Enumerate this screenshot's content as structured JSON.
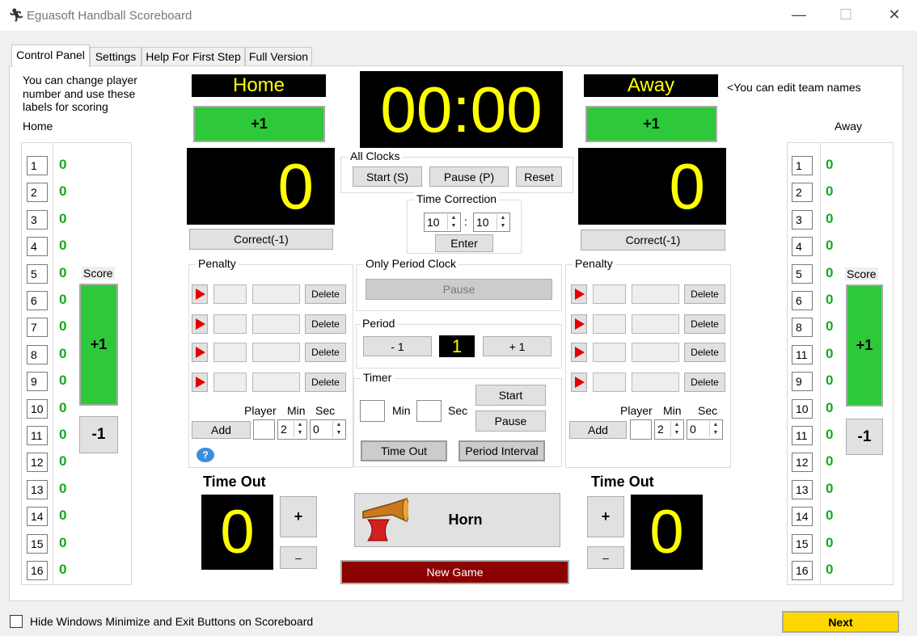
{
  "window": {
    "title": "Eguasoft Handball Scoreboard",
    "app_icon": "player-icon",
    "min": "—",
    "max": "☐",
    "close": "✕"
  },
  "tabs": [
    {
      "label": "Control Panel"
    },
    {
      "label": "Settings"
    },
    {
      "label": "Help For First Step"
    },
    {
      "label": "Full Version"
    }
  ],
  "left_note": {
    "line1": "You can change player",
    "line2": "number and use these",
    "line3": "labels for scoring",
    "side": "Home"
  },
  "right_note": {
    "edit_names": "<You can edit team names",
    "side": "Away"
  },
  "home": {
    "name": "Home",
    "plus": "+1",
    "score": "0",
    "correct": "Correct(-1)",
    "players": [
      "1",
      "2",
      "3",
      "4",
      "5",
      "6",
      "7",
      "8",
      "9",
      "10",
      "11",
      "12",
      "13",
      "14",
      "15",
      "16"
    ],
    "player_scores": [
      "0",
      "0",
      "0",
      "0",
      "0",
      "0",
      "0",
      "0",
      "0",
      "0",
      "0",
      "0",
      "0",
      "0",
      "0",
      "0"
    ],
    "score_label": "Score",
    "side_plus": "+1",
    "side_minus": "-1",
    "timeout_title": "Time Out",
    "timeout_value": "0",
    "timeout_plus": "+",
    "timeout_minus": "–"
  },
  "away": {
    "name": "Away",
    "plus": "+1",
    "score": "0",
    "correct": "Correct(-1)",
    "players": [
      "1",
      "2",
      "3",
      "4",
      "5",
      "6",
      "8",
      "11",
      "9",
      "10",
      "11",
      "12",
      "13",
      "14",
      "15",
      "16"
    ],
    "player_scores": [
      "0",
      "0",
      "0",
      "0",
      "0",
      "0",
      "0",
      "0",
      "0",
      "0",
      "0",
      "0",
      "0",
      "0",
      "0",
      "0"
    ],
    "score_label": "Score",
    "side_plus": "+1",
    "side_minus": "-1",
    "timeout_title": "Time Out",
    "timeout_value": "0",
    "timeout_plus": "+",
    "timeout_minus": "–"
  },
  "clock": {
    "time": "00:00"
  },
  "all_clocks": {
    "title": "All Clocks",
    "start": "Start (S)",
    "pause": "Pause (P)",
    "reset": "Reset"
  },
  "time_correction": {
    "title": "Time Correction",
    "min": "10",
    "sep": ":",
    "sec": "10",
    "enter": "Enter"
  },
  "penalty": {
    "title": "Penalty",
    "delete": "Delete",
    "player": "Player",
    "min": "Min",
    "sec": "Sec",
    "add": "Add",
    "min_value": "2",
    "sec_value": "0",
    "help_icon": "question-icon"
  },
  "period_clock": {
    "title": "Only Period Clock",
    "pause": "Pause"
  },
  "period": {
    "title": "Period",
    "minus": "- 1",
    "value": "1",
    "plus": "+ 1"
  },
  "timer": {
    "title": "Timer",
    "min": "Min",
    "sec": "Sec",
    "start": "Start",
    "pause": "Pause",
    "timeout": "Time Out",
    "interval": "Period Interval"
  },
  "horn": {
    "label": "Horn",
    "icon": "horn-icon"
  },
  "new_game": "New Game",
  "footer": {
    "checkbox": "Hide Windows Minimize and Exit Buttons on Scoreboard",
    "next": "Next"
  }
}
